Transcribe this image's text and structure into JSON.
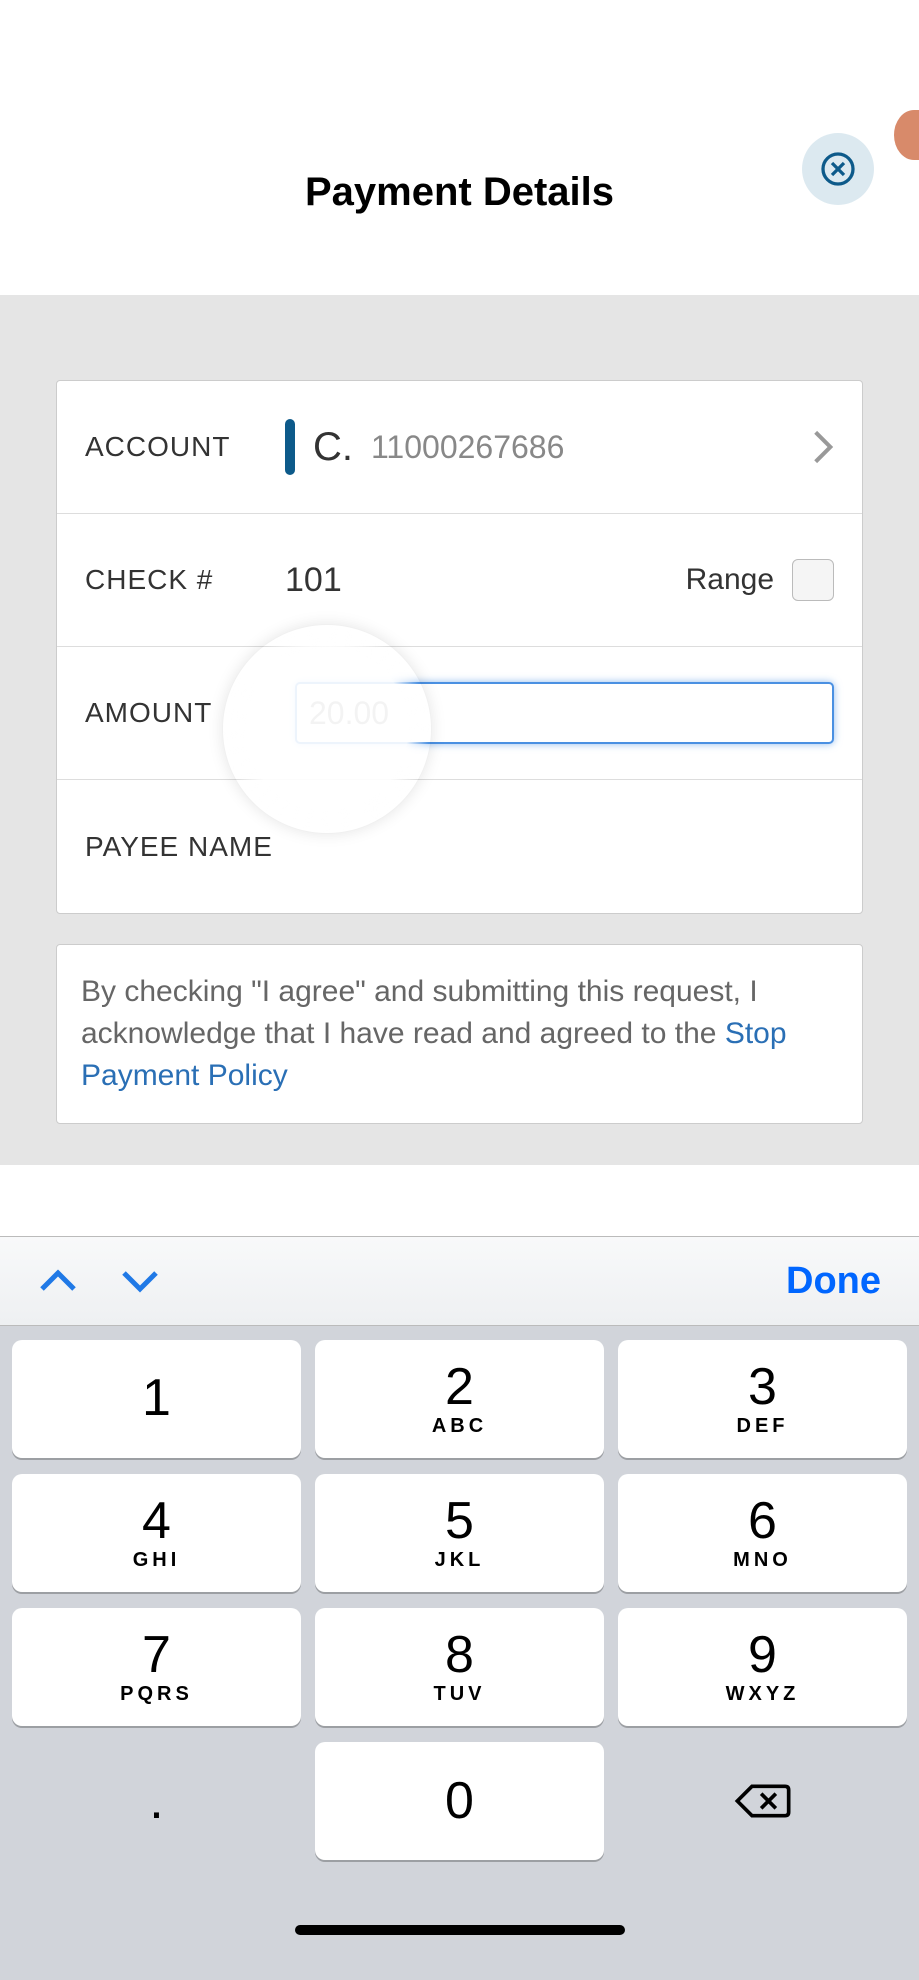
{
  "header": {
    "title": "Payment Details"
  },
  "form": {
    "account": {
      "label": "ACCOUNT",
      "prefix": "C.",
      "number": "11000267686"
    },
    "check": {
      "label": "CHECK #",
      "value": "101",
      "range_label": "Range"
    },
    "amount": {
      "label": "AMOUNT",
      "value": "20.00"
    },
    "payee": {
      "label": "PAYEE NAME"
    }
  },
  "terms": {
    "text_part1": "By checking \"I agree\" and submitting this request, I acknowledge that I have read and agreed to the ",
    "link": "Stop Payment Policy"
  },
  "keyboard": {
    "done": "Done",
    "keys": [
      {
        "digit": "1",
        "letters": ""
      },
      {
        "digit": "2",
        "letters": "ABC"
      },
      {
        "digit": "3",
        "letters": "DEF"
      },
      {
        "digit": "4",
        "letters": "GHI"
      },
      {
        "digit": "5",
        "letters": "JKL"
      },
      {
        "digit": "6",
        "letters": "MNO"
      },
      {
        "digit": "7",
        "letters": "PQRS"
      },
      {
        "digit": "8",
        "letters": "TUV"
      },
      {
        "digit": "9",
        "letters": "WXYZ"
      },
      {
        "digit": ".",
        "letters": ""
      },
      {
        "digit": "0",
        "letters": ""
      }
    ]
  }
}
